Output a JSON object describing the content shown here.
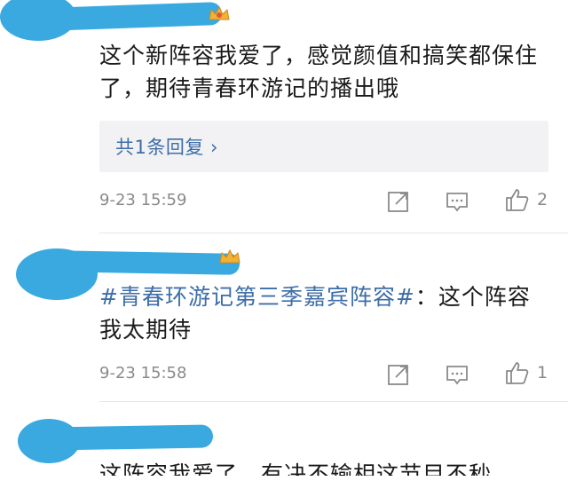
{
  "comments": [
    {
      "text": "这个新阵容我爱了，感觉颜值和搞笑都保住了，期待青春环游记的播出哦",
      "reply_link": "共1条回复 ›",
      "time": "9-23 15:59",
      "likes": "2"
    },
    {
      "topic": "#青春环游记第三季嘉宾阵容#",
      "text": "：这个阵容我太期待",
      "time": "9-23 15:58",
      "likes": "1"
    },
    {
      "text": "这阵容我爱了，有决不输相这节目不秒"
    }
  ],
  "icons": {
    "share": "share-icon",
    "comment": "comment-icon",
    "like": "thumbs-up-icon",
    "badge": "crown-badge-icon"
  },
  "colors": {
    "link": "#3d6ea8",
    "redaction": "#39a9e0",
    "meta": "#8a8a8a",
    "reply_bg": "#f2f2f4"
  }
}
